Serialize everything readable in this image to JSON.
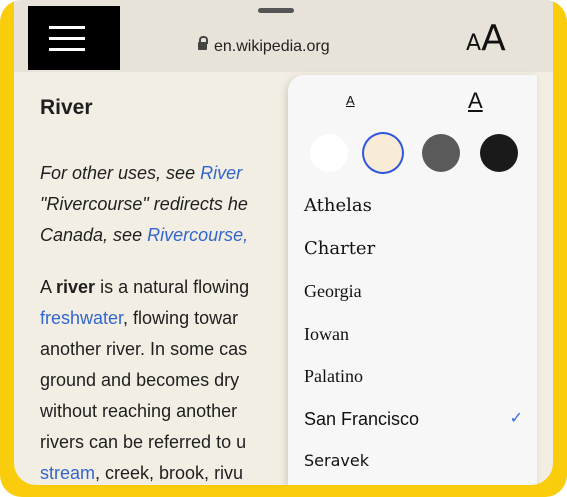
{
  "browser": {
    "url": "en.wikipedia.org",
    "text_size_label_small": "A",
    "text_size_label_large": "A"
  },
  "article": {
    "title": "River",
    "hatnote_lines": [
      {
        "pre": "For other uses, see ",
        "link": "River",
        "post": ""
      },
      {
        "pre": "\"Rivercourse\" redirects he",
        "link": "",
        "post": ""
      },
      {
        "pre": "Canada, see ",
        "link": "Rivercourse,",
        "post": ""
      }
    ],
    "body_lines": [
      {
        "pre": "A ",
        "bold": "river",
        "post": " is a natural flowing",
        "link": ""
      },
      {
        "pre": "",
        "bold": "",
        "post": ", flowing towar",
        "link": "freshwater"
      },
      {
        "pre": "another river. In some cas",
        "bold": "",
        "post": "",
        "link": ""
      },
      {
        "pre": "ground and becomes dry",
        "bold": "",
        "post": "",
        "link": ""
      },
      {
        "pre": "without reaching another",
        "bold": "",
        "post": "",
        "link": ""
      },
      {
        "pre": "rivers can be referred to u",
        "bold": "",
        "post": "",
        "link": ""
      },
      {
        "pre": "",
        "bold": "",
        "post": ", creek, brook, rivu",
        "link": "stream"
      }
    ]
  },
  "reader_settings": {
    "font_size_small": "A",
    "font_size_large": "A",
    "themes": [
      {
        "name": "white",
        "color": "#ffffff",
        "selected": false
      },
      {
        "name": "sepia",
        "color": "#f8ecd6",
        "selected": true
      },
      {
        "name": "gray",
        "color": "#5a5a5a",
        "selected": false
      },
      {
        "name": "black",
        "color": "#1a1a1a",
        "selected": false
      }
    ],
    "selection_color": "#2f55e0",
    "fonts": [
      {
        "label": "Athelas",
        "selected": false
      },
      {
        "label": "Charter",
        "selected": false
      },
      {
        "label": "Georgia",
        "selected": false
      },
      {
        "label": "Iowan",
        "selected": false
      },
      {
        "label": "Palatino",
        "selected": false
      },
      {
        "label": "San Francisco",
        "selected": true
      },
      {
        "label": "Seravek",
        "selected": false
      }
    ],
    "check_mark": "✓"
  }
}
